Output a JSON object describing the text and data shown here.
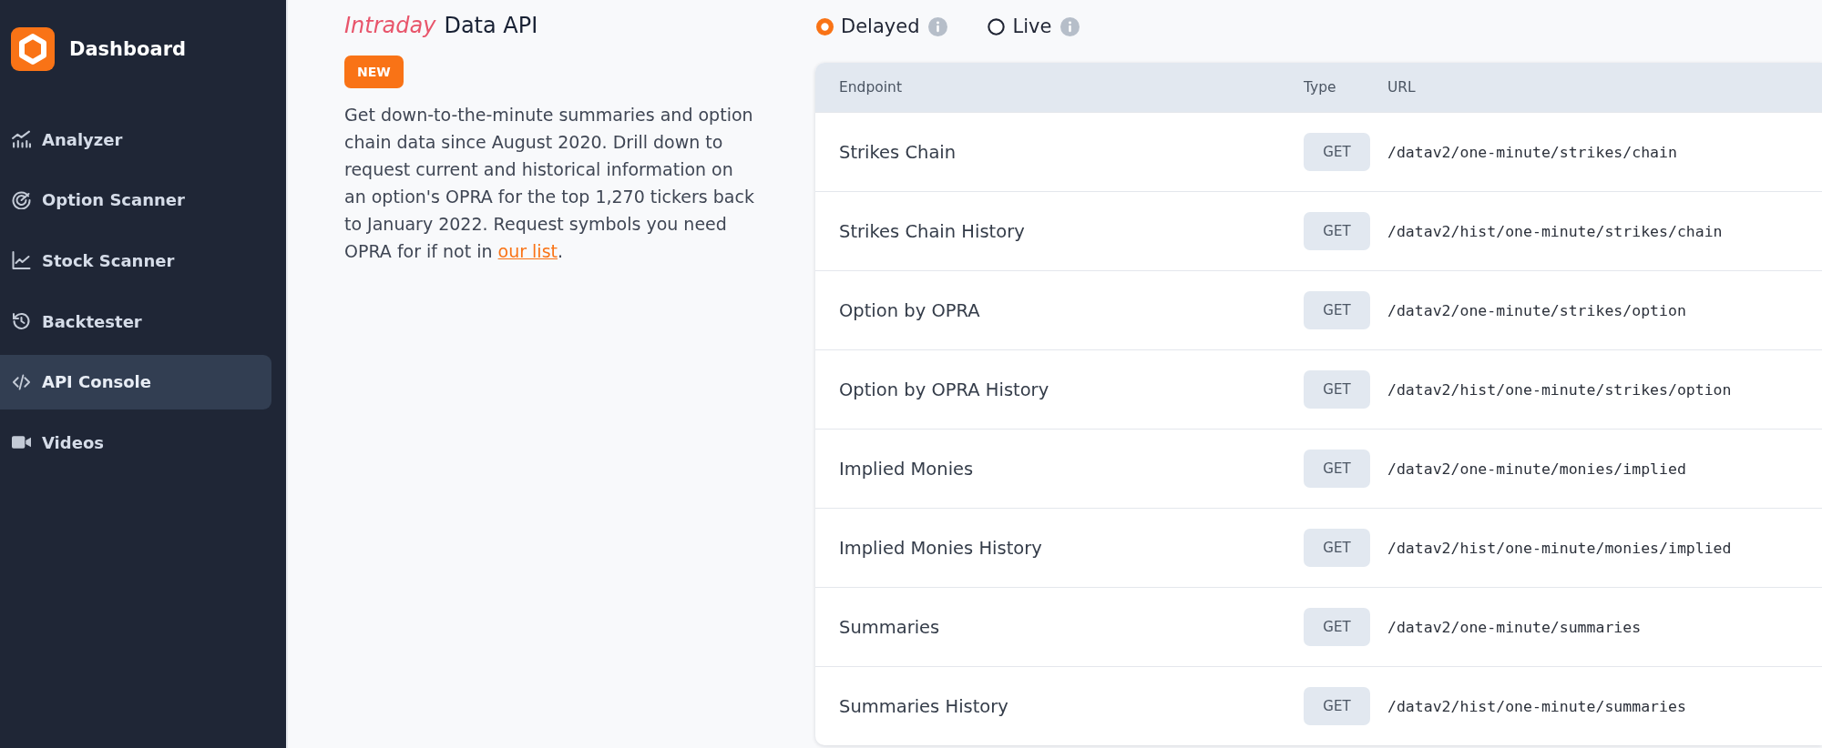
{
  "sidebar": {
    "brand": "Dashboard",
    "items": [
      {
        "label": "Analyzer",
        "selected": false
      },
      {
        "label": "Option Scanner",
        "selected": false
      },
      {
        "label": "Stock Scanner",
        "selected": false
      },
      {
        "label": "Backtester",
        "selected": false
      },
      {
        "label": "API Console",
        "selected": true
      },
      {
        "label": "Videos",
        "selected": false
      }
    ]
  },
  "intro": {
    "title_emphasis": "Intraday",
    "title": "Data API",
    "badge": "NEW",
    "description": "Get down-to-the-minute summaries and option chain data since August 2020. Drill down to request current and historical information on an option's OPRA for the top 1,270 tickers back to January 2022. Request symbols you need OPRA for if not in",
    "link": "our list",
    "description_end": "."
  },
  "feed_options": [
    {
      "label": "Delayed",
      "selected": true
    },
    {
      "label": "Live",
      "selected": false
    }
  ],
  "table": {
    "columns": [
      "Endpoint",
      "Type",
      "URL"
    ],
    "rows": [
      {
        "endpoint": "Strikes Chain",
        "type": "GET",
        "url": "/datav2/one-minute/strikes/chain"
      },
      {
        "endpoint": "Strikes Chain History",
        "type": "GET",
        "url": "/datav2/hist/one-minute/strikes/chain"
      },
      {
        "endpoint": "Option by OPRA",
        "type": "GET",
        "url": "/datav2/one-minute/strikes/option"
      },
      {
        "endpoint": "Option by OPRA History",
        "type": "GET",
        "url": "/datav2/hist/one-minute/strikes/option"
      },
      {
        "endpoint": "Implied Monies",
        "type": "GET",
        "url": "/datav2/one-minute/monies/implied"
      },
      {
        "endpoint": "Implied Monies History",
        "type": "GET",
        "url": "/datav2/hist/one-minute/monies/implied"
      },
      {
        "endpoint": "Summaries",
        "type": "GET",
        "url": "/datav2/one-minute/summaries"
      },
      {
        "endpoint": "Summaries History",
        "type": "GET",
        "url": "/datav2/hist/one-minute/summaries"
      }
    ]
  }
}
